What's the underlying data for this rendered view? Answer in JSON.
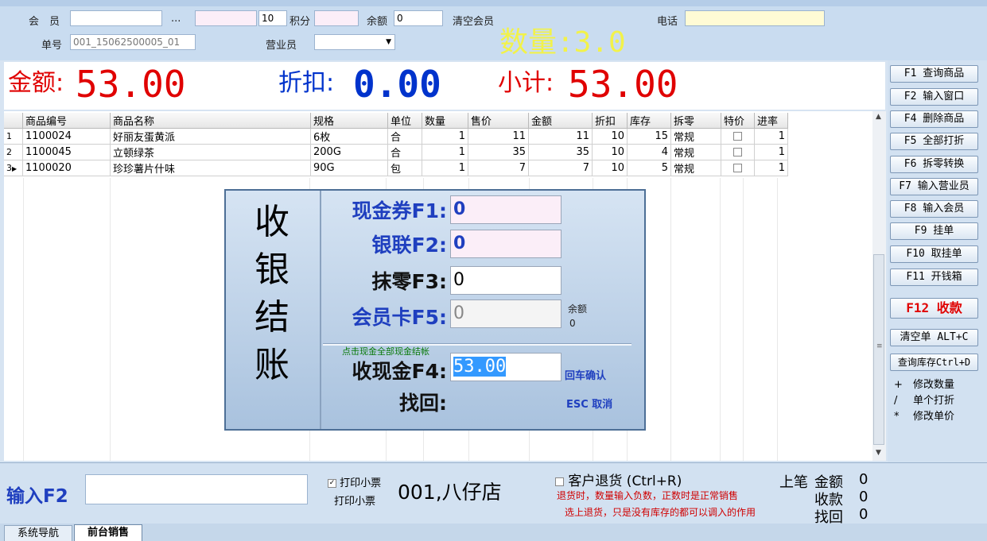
{
  "header": {
    "member_label": "会　员",
    "ellipsis": "...",
    "points_value": "10",
    "points_label": "积分",
    "balance_label": "余额",
    "balance_value": "0",
    "clear_member": "清空会员",
    "phone_label": "电话",
    "order_no_label": "单号",
    "order_no_value": "001_15062500005_01",
    "salesperson_label": "营业员",
    "quantity_display": "数量:3.0"
  },
  "totals": {
    "amount_label": "金额:",
    "amount_value": "53.00",
    "discount_label": "折扣:",
    "discount_value": "0.00",
    "subtotal_label": "小计:",
    "subtotal_value": "53.00"
  },
  "grid": {
    "columns": [
      "商品编号",
      "商品名称",
      "规格",
      "单位",
      "数量",
      "售价",
      "金额",
      "折扣",
      "库存",
      "拆零",
      "特价",
      "进率"
    ],
    "rows": [
      {
        "idx": "1",
        "code": "1100024",
        "name": "好丽友蛋黄派",
        "spec": "6枚",
        "unit": "合",
        "qty": "1",
        "price": "11",
        "amount": "11",
        "disc": "10",
        "stock": "15",
        "split": "常规",
        "special": "",
        "rate": "1"
      },
      {
        "idx": "2",
        "code": "1100045",
        "name": "立顿绿茶",
        "spec": "200G",
        "unit": "合",
        "qty": "1",
        "price": "35",
        "amount": "35",
        "disc": "10",
        "stock": "4",
        "split": "常规",
        "special": "",
        "rate": "1"
      },
      {
        "idx": "3",
        "code": "1100020",
        "name": "珍珍薯片什味",
        "spec": "90G",
        "unit": "包",
        "qty": "1",
        "price": "7",
        "amount": "7",
        "disc": "10",
        "stock": "5",
        "split": "常规",
        "special": "",
        "rate": "1"
      }
    ]
  },
  "checkout": {
    "title_chars": [
      "收",
      "银",
      "结",
      "账"
    ],
    "voucher_label": "现金券F1:",
    "voucher_value": "0",
    "unionpay_label": "银联F2:",
    "unionpay_value": "0",
    "rounding_label": "抹零F3:",
    "rounding_value": "0",
    "member_card_label": "会员卡F5:",
    "member_card_value": "0",
    "balance_label": "余额",
    "balance_value": "0",
    "hint_all_cash": "点击现金全部现金结帐",
    "cash_label": "收现金F4:",
    "cash_value": "53.00",
    "enter_confirm": "回车确认",
    "change_label": "找回:",
    "esc_cancel": "ESC 取消"
  },
  "side_buttons": [
    "F1 查询商品",
    "F2 输入窗口",
    "F4 删除商品",
    "F5 全部打折",
    "F6 拆零转换",
    "F7 输入营业员",
    "F8 输入会员",
    "F9 挂单",
    "F10 取挂单",
    "F11 开钱箱"
  ],
  "side": {
    "checkout_button": "F12 收款",
    "clear_button": "清空单 ALT+C",
    "stock_button": "查询库存Ctrl+D",
    "hints": [
      {
        "key": "+",
        "text": "修改数量"
      },
      {
        "key": "/",
        "text": "单个打折"
      },
      {
        "key": "*",
        "text": "修改单价"
      }
    ]
  },
  "bottom": {
    "input_label": "输入F2",
    "print_receipt": "打印小票",
    "print_receipt2": "打印小票",
    "store": "001,八仔店",
    "return_label": "客户退货 (Ctrl+R)",
    "return_note1": "退货时，数量输入负数，正数时是正常销售",
    "return_note2": "选上退货，只是没有库存的都可以调入的作用",
    "last_label": "上笔",
    "last_amount_label": "金额",
    "last_amount": "0",
    "last_received_label": "收款",
    "last_received": "0",
    "last_change_label": "找回",
    "last_change": "0"
  },
  "tabs": [
    "系统导航",
    "前台销售"
  ],
  "colors": {
    "red": "#e00000",
    "blue": "#0033cc",
    "yellow": "#f2f24a",
    "dialog_blue": "#1f3fbf"
  }
}
